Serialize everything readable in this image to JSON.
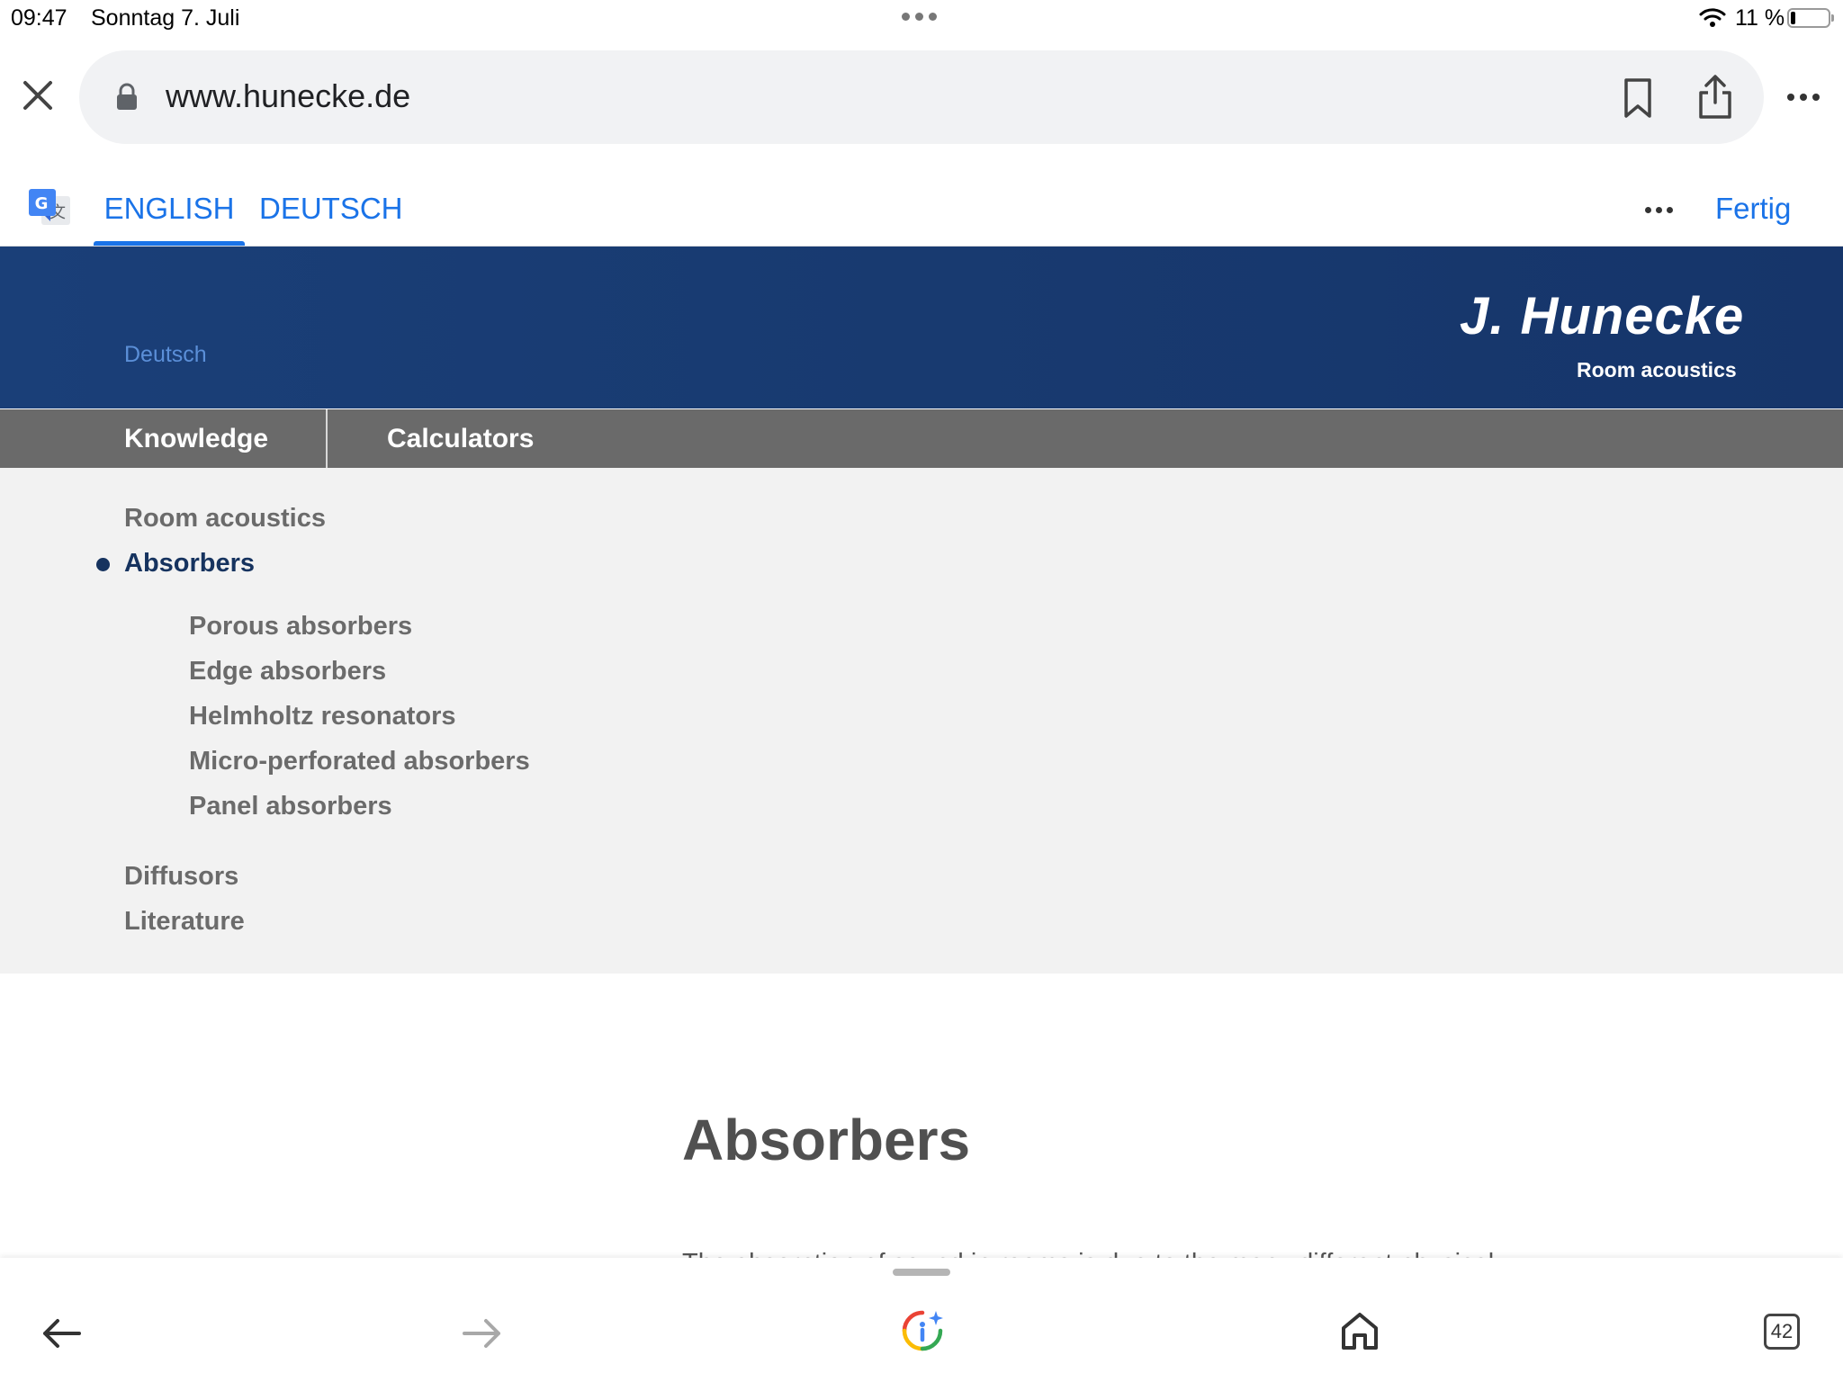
{
  "status_bar": {
    "time": "09:47",
    "date": "Sonntag 7. Juli",
    "battery": "11 %"
  },
  "browser": {
    "url": "www.hunecke.de",
    "tab_count": "42"
  },
  "translate_bar": {
    "lang_english": "ENGLISH",
    "lang_german": "DEUTSCH",
    "done_label": "Fertig"
  },
  "site": {
    "language_link": "Deutsch",
    "brand_name": "J. Hunecke",
    "brand_tagline": "Room acoustics",
    "nav": {
      "knowledge": "Knowledge",
      "calculators": "Calculators"
    },
    "menu": {
      "room_acoustics": "Room acoustics",
      "absorbers": "Absorbers",
      "sub": [
        "Porous absorbers",
        "Edge absorbers",
        "Helmholtz resonators",
        "Micro-perforated absorbers",
        "Panel absorbers"
      ],
      "diffusors": "Diffusors",
      "literature": "Literature"
    },
    "page_title": "Absorbers",
    "intro_peek": "The absorption of sound in rooms is due to the many different physical"
  },
  "colors": {
    "header_blue": "#183a70",
    "nav_gray": "#6a6a6a",
    "menu_bg": "#f2f2f2",
    "link_blue": "#1a73e8",
    "active_navy": "#16335f"
  },
  "icons": [
    "close-icon",
    "lock-icon",
    "bookmark-icon",
    "share-icon",
    "more-icon",
    "google-translate-icon",
    "back-arrow-icon",
    "forward-arrow-icon",
    "google-lens-icon",
    "home-icon",
    "tabs-icon",
    "wifi-icon",
    "battery-icon"
  ]
}
